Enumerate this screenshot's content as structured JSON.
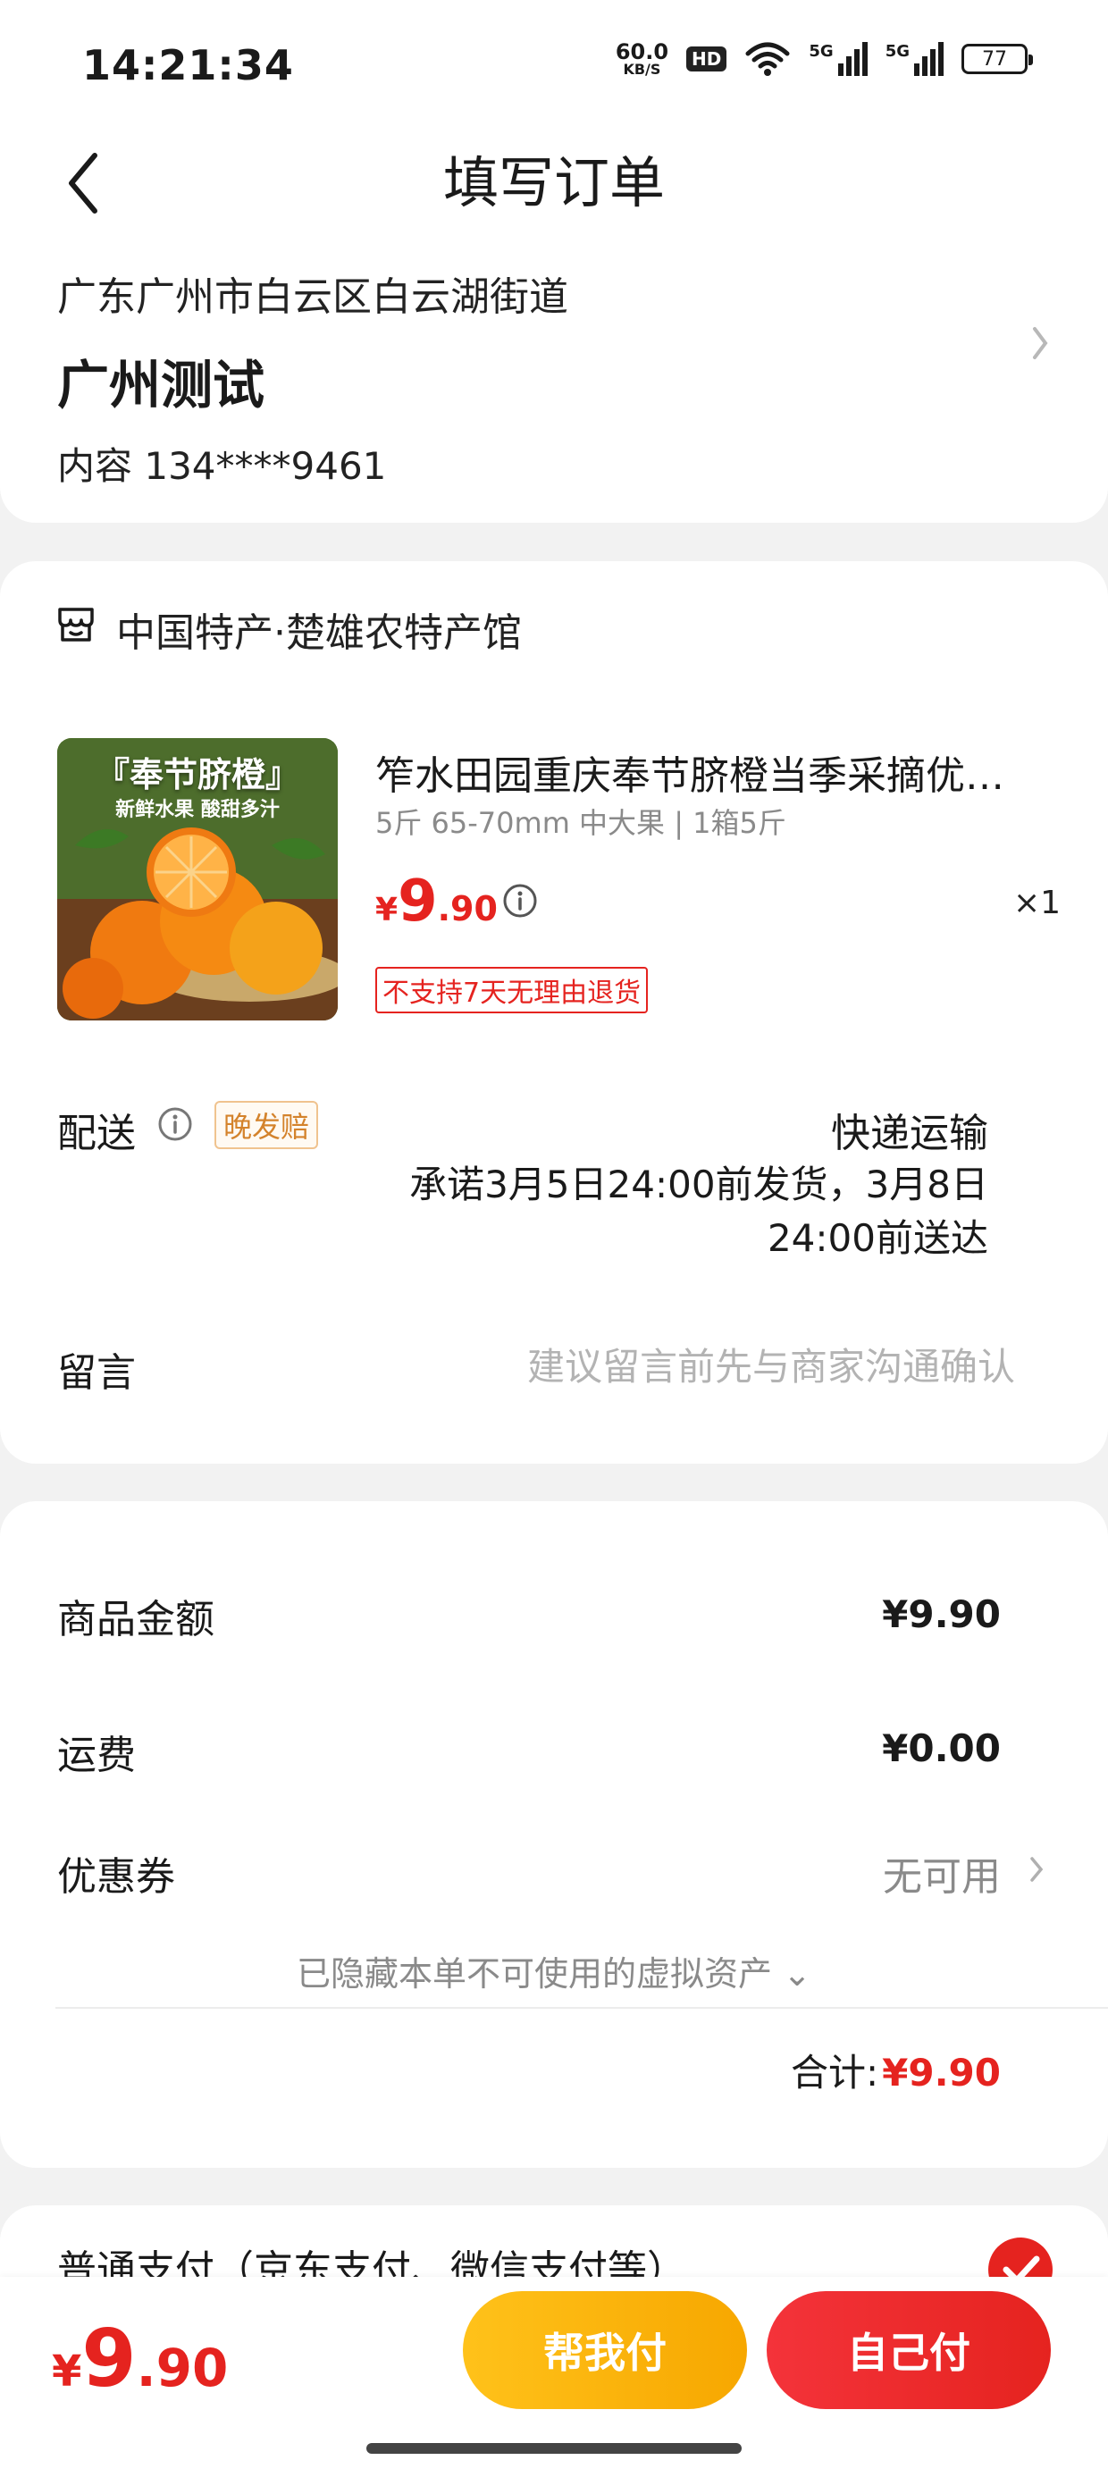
{
  "status_bar": {
    "time": "14:21:34",
    "net_speed": "60.0",
    "net_unit": "KB/S",
    "hd_badge": "HD",
    "sim1": "5G",
    "sim2": "5G",
    "battery": "77"
  },
  "header": {
    "title": "填写订单"
  },
  "address": {
    "region": "广东广州市白云区白云湖街道",
    "name": "广州测试",
    "contact": "内容  134****9461"
  },
  "store": {
    "name": "中国特产·楚雄农特产馆"
  },
  "product": {
    "title": "笮水田园重庆奉节脐橙当季采摘优质大果",
    "spec": "5斤 65-70mm 中大果 | 1箱5斤",
    "price_currency": "¥",
    "price_int": "9",
    "price_dec": ".90",
    "quantity": "×1",
    "return_tag": "不支持7天无理由退货",
    "image_banner": "『奉节脐橙』",
    "image_sub": "新鲜水果 酸甜多汁"
  },
  "delivery": {
    "label": "配送",
    "late_tag": "晚发赔",
    "method": "快递运输",
    "promise": "承诺3月5日24:00前发货，3月8日24:00前送达"
  },
  "message": {
    "label": "留言",
    "placeholder": "建议留言前先与商家沟通确认"
  },
  "amounts": {
    "goods_label": "商品金额",
    "goods_value": "¥9.90",
    "shipping_label": "运费",
    "shipping_value": "¥0.00",
    "coupon_label": "优惠券",
    "coupon_value": "无可用",
    "hidden_assets": "已隐藏本单不可使用的虚拟资产 ⌄",
    "total_label": "合计:",
    "total_value": "¥9.90"
  },
  "payment": {
    "method": "普通支付（京东支付、微信支付等）"
  },
  "bottom_bar": {
    "currency": "¥",
    "price_int": "9",
    "price_dec": ".90",
    "help_pay": "帮我付",
    "self_pay": "自己付"
  },
  "colors": {
    "accent_red": "#e5231f",
    "accent_yellow": "#f7a700"
  }
}
